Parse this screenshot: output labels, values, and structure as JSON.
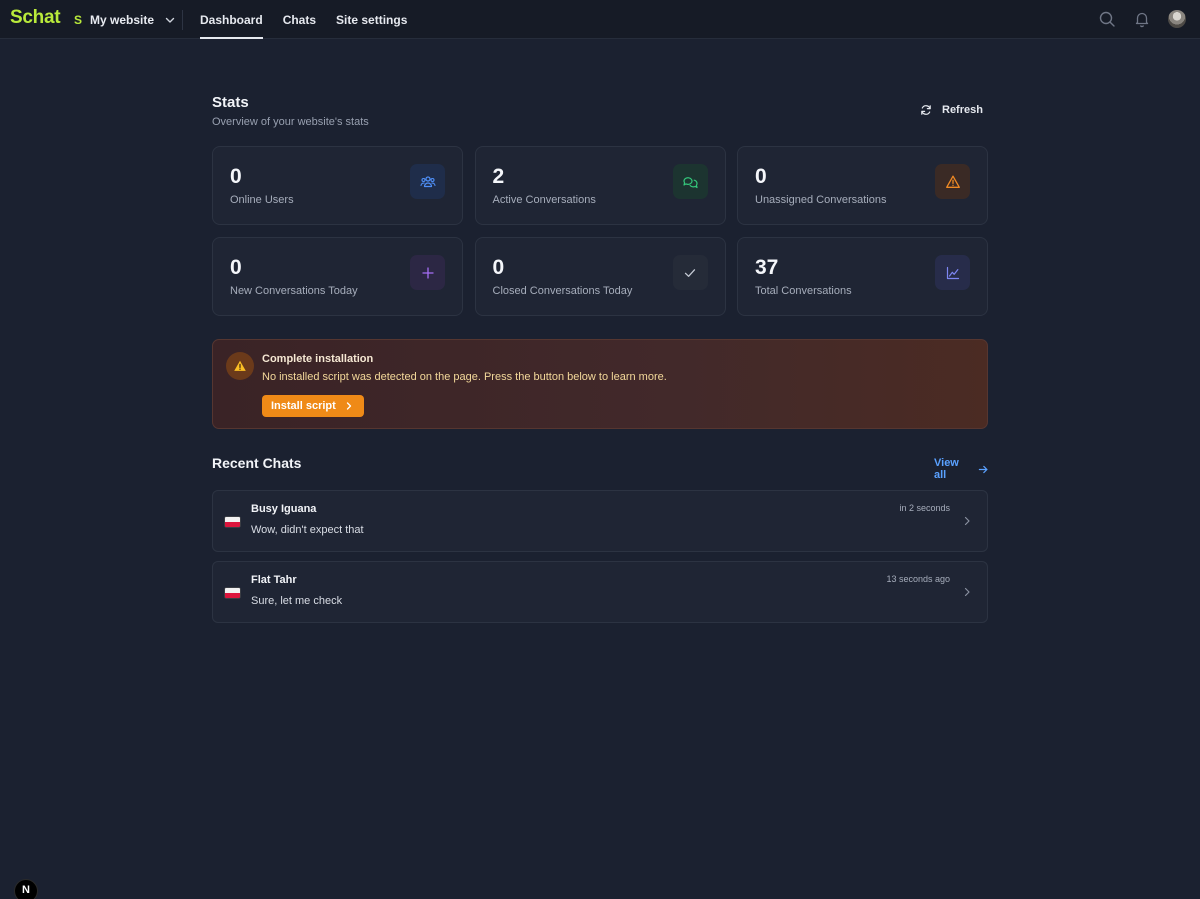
{
  "app": {
    "logo": "Schat",
    "site_badge": "S",
    "site_name": "My website"
  },
  "nav": {
    "tabs": [
      {
        "label": "Dashboard",
        "active": true
      },
      {
        "label": "Chats",
        "active": false
      },
      {
        "label": "Site settings",
        "active": false
      }
    ]
  },
  "topbar_icons": [
    "search-icon",
    "bell-icon",
    "user-avatar"
  ],
  "stats": {
    "title": "Stats",
    "subtitle": "Overview of your website's stats",
    "refresh_label": "Refresh",
    "cards": [
      {
        "value": "0",
        "label": "Online Users",
        "icon": "users-icon",
        "color": "#4f8ff7"
      },
      {
        "value": "2",
        "label": "Active Conversations",
        "icon": "chat-bubbles-icon",
        "color": "#34c77b"
      },
      {
        "value": "0",
        "label": "Unassigned Conversations",
        "icon": "warning-icon",
        "color": "#f08a24"
      },
      {
        "value": "0",
        "label": "New Conversations Today",
        "icon": "plus-icon",
        "color": "#a66ef5"
      },
      {
        "value": "0",
        "label": "Closed Conversations Today",
        "icon": "check-icon",
        "color": "#c5cad4"
      },
      {
        "value": "37",
        "label": "Total Conversations",
        "icon": "line-chart-icon",
        "color": "#7d86f3"
      }
    ]
  },
  "banner": {
    "title": "Complete installation",
    "text": "No installed script was detected on the page. Press the button below to learn more.",
    "button_label": "Install script",
    "accent": "#ef8a17"
  },
  "recent": {
    "title": "Recent Chats",
    "view_all_label": "View all",
    "chats": [
      {
        "name": "Busy Iguana",
        "message": "Wow, didn't expect that",
        "time": "in 2 seconds"
      },
      {
        "name": "Flat Tahr",
        "message": "Sure, let me check",
        "time": "13 seconds ago"
      }
    ]
  },
  "dev_badge": "N"
}
